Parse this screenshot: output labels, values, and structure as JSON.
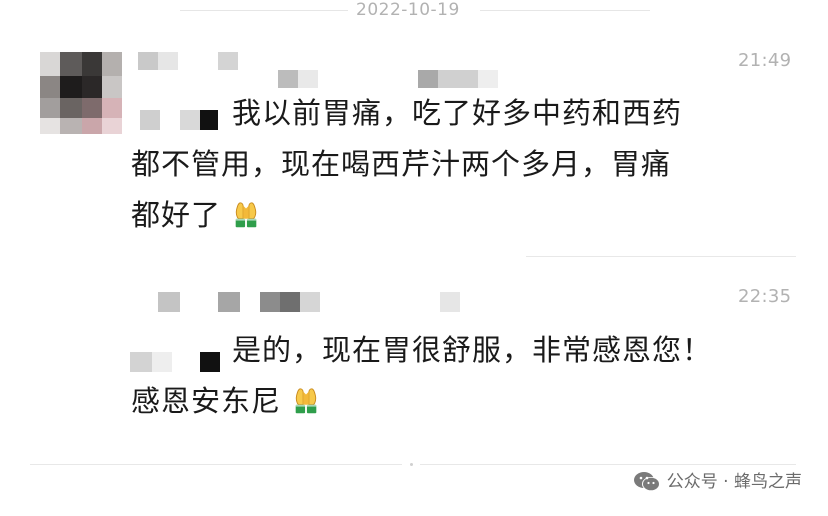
{
  "date": "2022-10-19",
  "messages": [
    {
      "time": "21:49",
      "lines": [
        "我以前胃痛，吃了好多中药和西药",
        "都不管用，现在喝西芹汁两个多月，胃痛",
        "都好了"
      ],
      "emoji": "folded-hands"
    },
    {
      "time": "22:35",
      "lines": [
        "是的，现在胃很舒服，非常感恩您！",
        "感恩安东尼"
      ],
      "emoji": "folded-hands"
    }
  ],
  "watermark": {
    "label": "公众号 · 蜂鸟之声",
    "icon": "wechat-icon"
  }
}
